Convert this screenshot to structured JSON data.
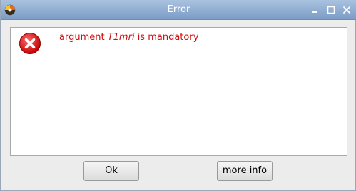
{
  "window": {
    "title": "Error",
    "controls": {
      "minimize": "–",
      "maximize": "□",
      "close": "✕"
    }
  },
  "message": {
    "prefix": "argument ",
    "argument": "T1mri",
    "suffix": " is mandatory",
    "color": "#cc1010"
  },
  "icons": {
    "app": "app-logo-icon",
    "error": "error-x-icon"
  },
  "buttons": {
    "ok_label": "Ok",
    "more_info_label": "more info"
  }
}
